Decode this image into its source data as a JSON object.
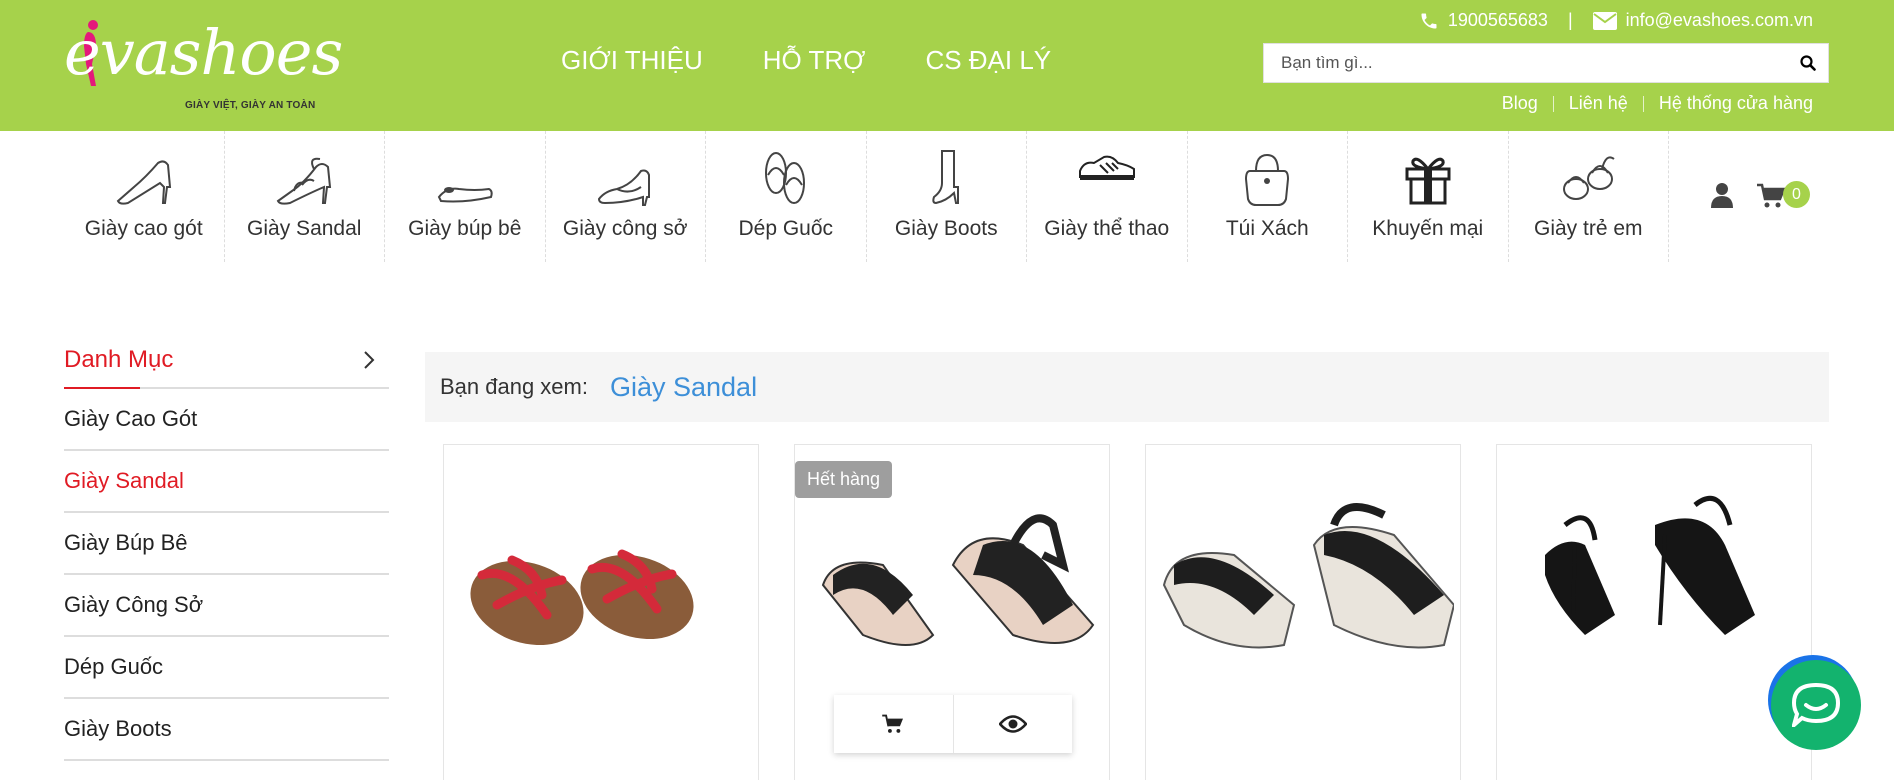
{
  "brand": {
    "name": "evashoes",
    "tagline": "GIÀY VIỆT, GIÀY AN TOÀN"
  },
  "main_nav": [
    "GIỚI THIỆU",
    "HỖ TRỢ",
    "CS ĐẠI LÝ"
  ],
  "contact": {
    "phone": "1900565683",
    "separator": "|",
    "email": "info@evashoes.com.vn"
  },
  "search": {
    "placeholder": "Bạn tìm gì..."
  },
  "sublinks": [
    "Blog",
    "Liên hệ",
    "Hệ thống cửa hàng"
  ],
  "categories": [
    {
      "label": "Giày cao gót",
      "icon": "high-heel-icon"
    },
    {
      "label": "Giày Sandal",
      "icon": "sandal-icon"
    },
    {
      "label": "Giày búp bê",
      "icon": "flat-shoe-icon"
    },
    {
      "label": "Giày công sở",
      "icon": "office-shoe-icon"
    },
    {
      "label": "Dép Guốc",
      "icon": "flip-flop-icon"
    },
    {
      "label": "Giày Boots",
      "icon": "boot-icon"
    },
    {
      "label": "Giày thể thao",
      "icon": "sneaker-icon"
    },
    {
      "label": "Túi Xách",
      "icon": "handbag-icon"
    },
    {
      "label": "Khuyến mại",
      "icon": "gift-icon"
    },
    {
      "label": "Giày trẻ em",
      "icon": "kids-shoe-icon"
    }
  ],
  "cart": {
    "count": "0"
  },
  "sidebar": {
    "title": "Danh Mục",
    "items": [
      {
        "label": "Giày Cao Gót",
        "active": false
      },
      {
        "label": "Giày Sandal",
        "active": true
      },
      {
        "label": "Giày Búp Bê",
        "active": false
      },
      {
        "label": "Giày Công Sở",
        "active": false
      },
      {
        "label": "Dép Guốc",
        "active": false
      },
      {
        "label": "Giày Boots",
        "active": false
      }
    ]
  },
  "breadcrumb": {
    "prefix": "Bạn đang xem:",
    "current": "Giày Sandal"
  },
  "products": [
    {
      "image": "red-strappy-flat-sandals",
      "badge": ""
    },
    {
      "image": "black-wedge-sandals",
      "badge": "Hết hàng"
    },
    {
      "image": "black-platform-wedge-sandals",
      "badge": ""
    },
    {
      "image": "black-high-heel-sandals",
      "badge": ""
    }
  ],
  "colors": {
    "brand_green": "#a6d24b",
    "accent_red": "#e01b24",
    "link_blue": "#3d8fd8",
    "chat_green": "#13b36e"
  }
}
